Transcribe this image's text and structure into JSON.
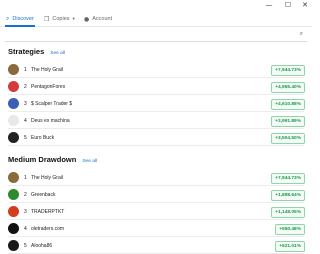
{
  "window": {
    "minimize_glyph": "—",
    "maximize_glyph": "☐",
    "close_glyph": "✕"
  },
  "nav": {
    "tabs": [
      {
        "label": "Discover",
        "icon": "search-icon",
        "active": true
      },
      {
        "label": "Copies",
        "icon": "copies-icon",
        "active": false
      },
      {
        "label": "Account",
        "icon": "person-icon",
        "active": false
      }
    ]
  },
  "search": {
    "icon": "search-icon"
  },
  "strategies": {
    "title": "Strategies",
    "see_all": "See all",
    "items": [
      {
        "rank": "1",
        "name": "The Holy Grail",
        "value": "+7,944.73%",
        "avatar_color": "#8a6a3a"
      },
      {
        "rank": "2",
        "name": "PentagonForex",
        "value": "+4,965.40%",
        "avatar_color": "#d43c3c"
      },
      {
        "rank": "3",
        "name": "$ Scalper Trader $",
        "value": "+4,610.88%",
        "avatar_color": "#3b5fb5"
      },
      {
        "rank": "4",
        "name": "Deus ex machina",
        "value": "+3,991.89%",
        "avatar_color": "#e8e8e8"
      },
      {
        "rank": "5",
        "name": "Euro Buck",
        "value": "+3,504.50%",
        "avatar_color": "#222222"
      }
    ]
  },
  "medium_drawdown": {
    "title": "Medium Drawdown",
    "see_all": "See all",
    "items": [
      {
        "rank": "1",
        "name": "The Holy Grail",
        "value": "+7,944.73%",
        "avatar_color": "#8a6a3a"
      },
      {
        "rank": "2",
        "name": "Greenback",
        "value": "+1,898.64%",
        "avatar_color": "#2f8a2f"
      },
      {
        "rank": "3",
        "name": "TRADERPTKT",
        "value": "+1,148.05%",
        "avatar_color": "#d43c1e"
      },
      {
        "rank": "4",
        "name": "oletraders.com",
        "value": "+550.48%",
        "avatar_color": "#111111"
      },
      {
        "rank": "5",
        "name": "Alooha86",
        "value": "+521.01%",
        "avatar_color": "#1a1a1a"
      }
    ]
  },
  "colors": {
    "accent": "#1a6fd6",
    "positive": "#1e9a4a",
    "badge_border": "#8fd6a6"
  }
}
